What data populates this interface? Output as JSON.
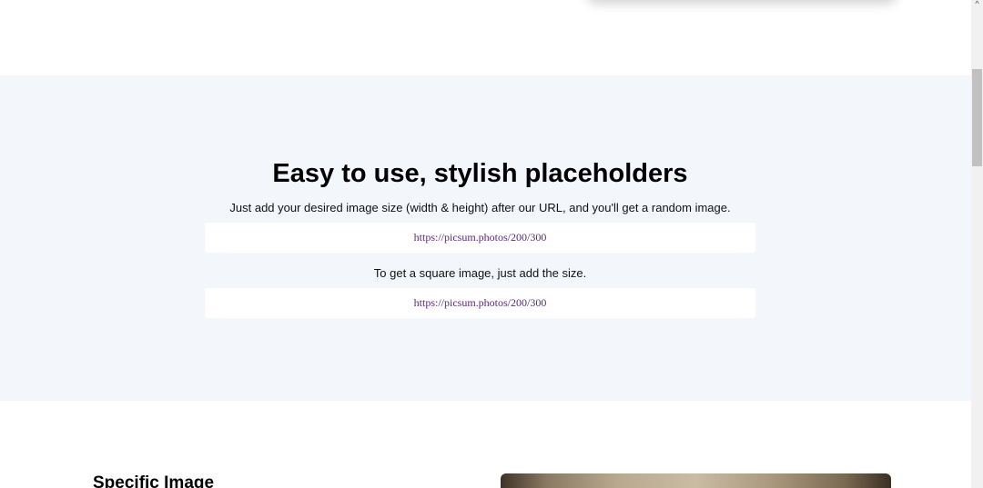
{
  "feature": {
    "title": "Easy to use, stylish placeholders",
    "description_random": "Just add your desired image size (width & height) after our URL, and you'll get a random image.",
    "example_url_random": "https://picsum.photos/200/300",
    "description_square": "To get a square image, just add the size.",
    "example_url_square": "https://picsum.photos/200/300"
  },
  "specific": {
    "heading": "Specific Image"
  },
  "scrollbar": {
    "up_arrow": "^",
    "icon": "chevron-up-icon"
  }
}
